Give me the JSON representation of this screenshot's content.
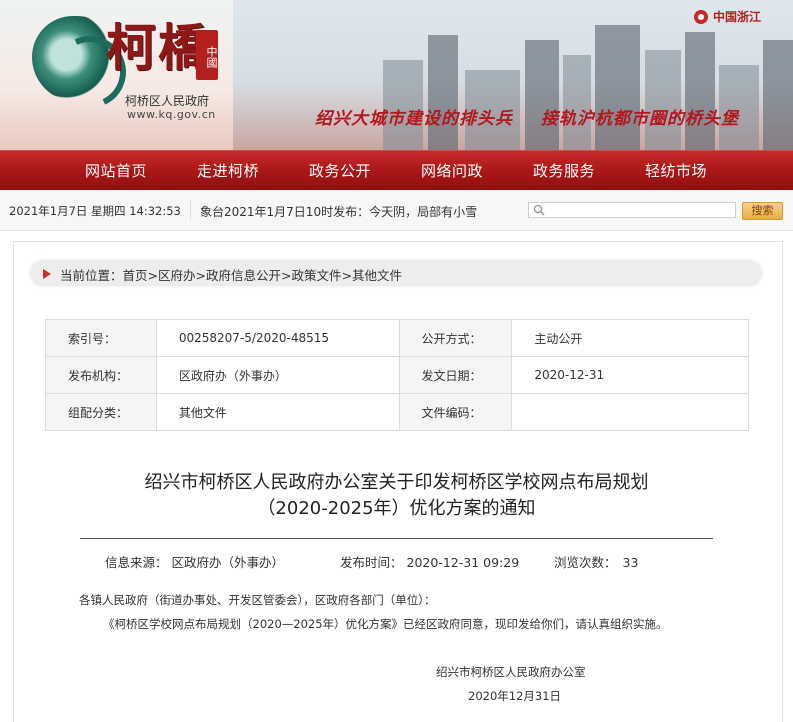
{
  "header": {
    "logo_text": "柯橋",
    "logo_seal": "中國",
    "gov_name": "柯桥区人民政府",
    "gov_url": "www.kq.gov.cn",
    "zhejiang_badge": "中国浙江",
    "slogans": [
      "绍兴大城市建设的排头兵",
      "接轨沪杭都市圈的桥头堡"
    ]
  },
  "nav": {
    "items": [
      "网站首页",
      "走进柯桥",
      "政务公开",
      "网络问政",
      "政务服务",
      "轻纺市场"
    ]
  },
  "infobar": {
    "date": "2021年1月7日 星期四 14:32:53",
    "weather": "象台2021年1月7日10时发布：今天阴，局部有小雪",
    "search_placeholder": "",
    "search_button": "搜索"
  },
  "breadcrumb": {
    "prefix": "当前位置：",
    "items": [
      "首页",
      "区府办",
      "政府信息公开",
      "政策文件",
      "其他文件"
    ],
    "sep": ">"
  },
  "meta_table": {
    "rows": [
      {
        "l1": "索引号：",
        "v1": "00258207-5/2020-48515",
        "l2": "公开方式：",
        "v2": "主动公开"
      },
      {
        "l1": "发布机构：",
        "v1": "区政府办（外事办）",
        "l2": "发文日期：",
        "v2": "2020-12-31"
      },
      {
        "l1": "组配分类：",
        "v1": "其他文件",
        "l2": "文件编码：",
        "v2": ""
      }
    ]
  },
  "document": {
    "title_line1": "绍兴市柯桥区人民政府办公室关于印发柯桥区学校网点布局规划",
    "title_line2": "（2020-2025年）优化方案的通知",
    "source_label": "信息来源：",
    "source": "区政府办（外事办）",
    "publish_label": "发布时间：",
    "publish_time": "2020-12-31 09:29",
    "views_label": "浏览次数：",
    "views": "33",
    "salutation": "各镇人民政府（街道办事处、开发区管委会），区政府各部门（单位）：",
    "body": "《柯桥区学校网点布局规划（2020—2025年）优化方案》已经区政府同意，现印发给你们，请认真组织实施。",
    "signature": "绍兴市柯桥区人民政府办公室",
    "sign_date": "2020年12月31日"
  }
}
